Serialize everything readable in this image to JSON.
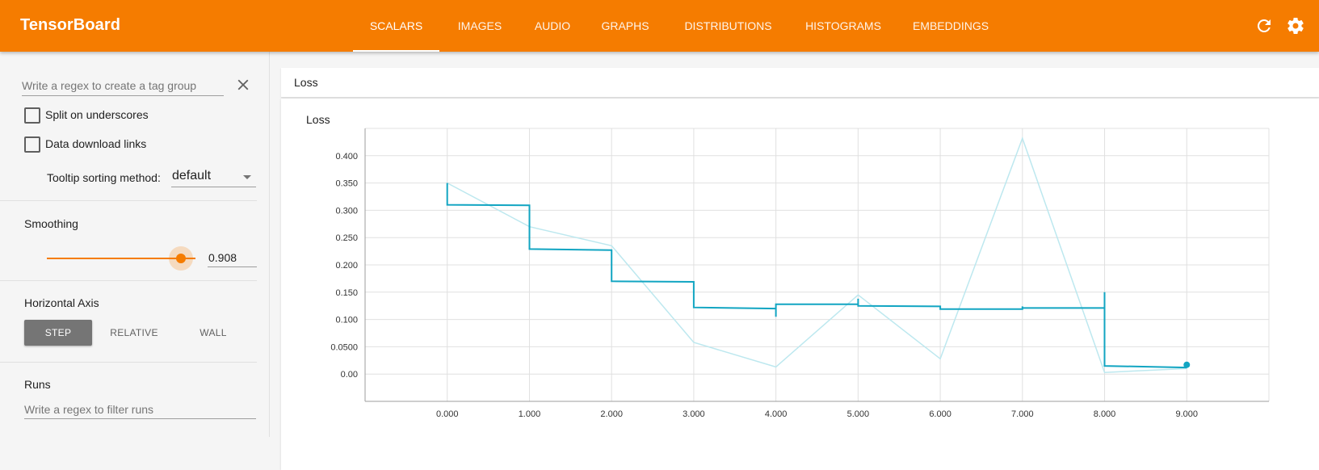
{
  "app": {
    "title": "TensorBoard"
  },
  "nav": {
    "tabs": [
      {
        "label": "SCALARS",
        "active": true
      },
      {
        "label": "IMAGES"
      },
      {
        "label": "AUDIO"
      },
      {
        "label": "GRAPHS"
      },
      {
        "label": "DISTRIBUTIONS"
      },
      {
        "label": "HISTOGRAMS"
      },
      {
        "label": "EMBEDDINGS"
      }
    ],
    "icons": [
      "refresh-icon",
      "settings-icon"
    ]
  },
  "sidebar": {
    "tag_regex": {
      "placeholder": "Write a regex to create a tag group",
      "value": ""
    },
    "split_on_underscores": {
      "label": "Split on underscores",
      "checked": false
    },
    "data_download_links": {
      "label": "Data download links",
      "checked": false
    },
    "tooltip_sorting": {
      "label": "Tooltip sorting method:",
      "value": "default"
    },
    "smoothing": {
      "title": "Smoothing",
      "value": "0.908",
      "fraction": 0.908
    },
    "horizontal_axis": {
      "title": "Horizontal Axis",
      "options": [
        {
          "label": "STEP",
          "active": true
        },
        {
          "label": "RELATIVE"
        },
        {
          "label": "WALL"
        }
      ]
    },
    "runs": {
      "title": "Runs",
      "placeholder": "Write a regex to filter runs",
      "value": ""
    }
  },
  "main": {
    "group_title": "Loss",
    "card_title": "Loss"
  },
  "colors": {
    "accent": "#f57c00",
    "series_smoothed": "#12a5c2",
    "series_raw": "#bde8ef"
  },
  "chart_data": {
    "type": "line",
    "title": "Loss",
    "x_ticks": [
      "0.000",
      "1.000",
      "2.000",
      "3.000",
      "4.000",
      "5.000",
      "6.000",
      "7.000",
      "8.000",
      "9.000"
    ],
    "y_ticks": [
      "0.00",
      "0.0500",
      "0.100",
      "0.150",
      "0.200",
      "0.250",
      "0.300",
      "0.350",
      "0.400"
    ],
    "xlim": [
      -1,
      10
    ],
    "ylim": [
      -0.05,
      0.45
    ],
    "grid": true,
    "series": [
      {
        "style": "raw",
        "x": [
          0,
          1,
          2,
          3,
          4,
          5,
          6,
          7,
          8,
          9
        ],
        "y": [
          0.35,
          0.27,
          0.235,
          0.058,
          0.013,
          0.145,
          0.028,
          0.432,
          0.003,
          0.01
        ]
      },
      {
        "style": "smoothed",
        "points": [
          [
            0,
            0.35
          ],
          [
            0,
            0.31
          ],
          [
            1,
            0.309
          ],
          [
            1,
            0.229
          ],
          [
            2,
            0.227
          ],
          [
            2,
            0.17
          ],
          [
            3,
            0.169
          ],
          [
            3,
            0.122
          ],
          [
            4,
            0.12
          ],
          [
            4,
            0.105
          ],
          [
            4,
            0.128
          ],
          [
            5,
            0.128
          ],
          [
            5,
            0.138
          ],
          [
            5,
            0.125
          ],
          [
            6,
            0.124
          ],
          [
            6,
            0.119
          ],
          [
            7,
            0.119
          ],
          [
            7,
            0.124
          ],
          [
            7,
            0.121
          ],
          [
            8,
            0.121
          ],
          [
            8,
            0.15
          ],
          [
            8,
            0.015
          ],
          [
            9,
            0.012
          ]
        ],
        "last_point": [
          9,
          0.017
        ]
      }
    ]
  }
}
